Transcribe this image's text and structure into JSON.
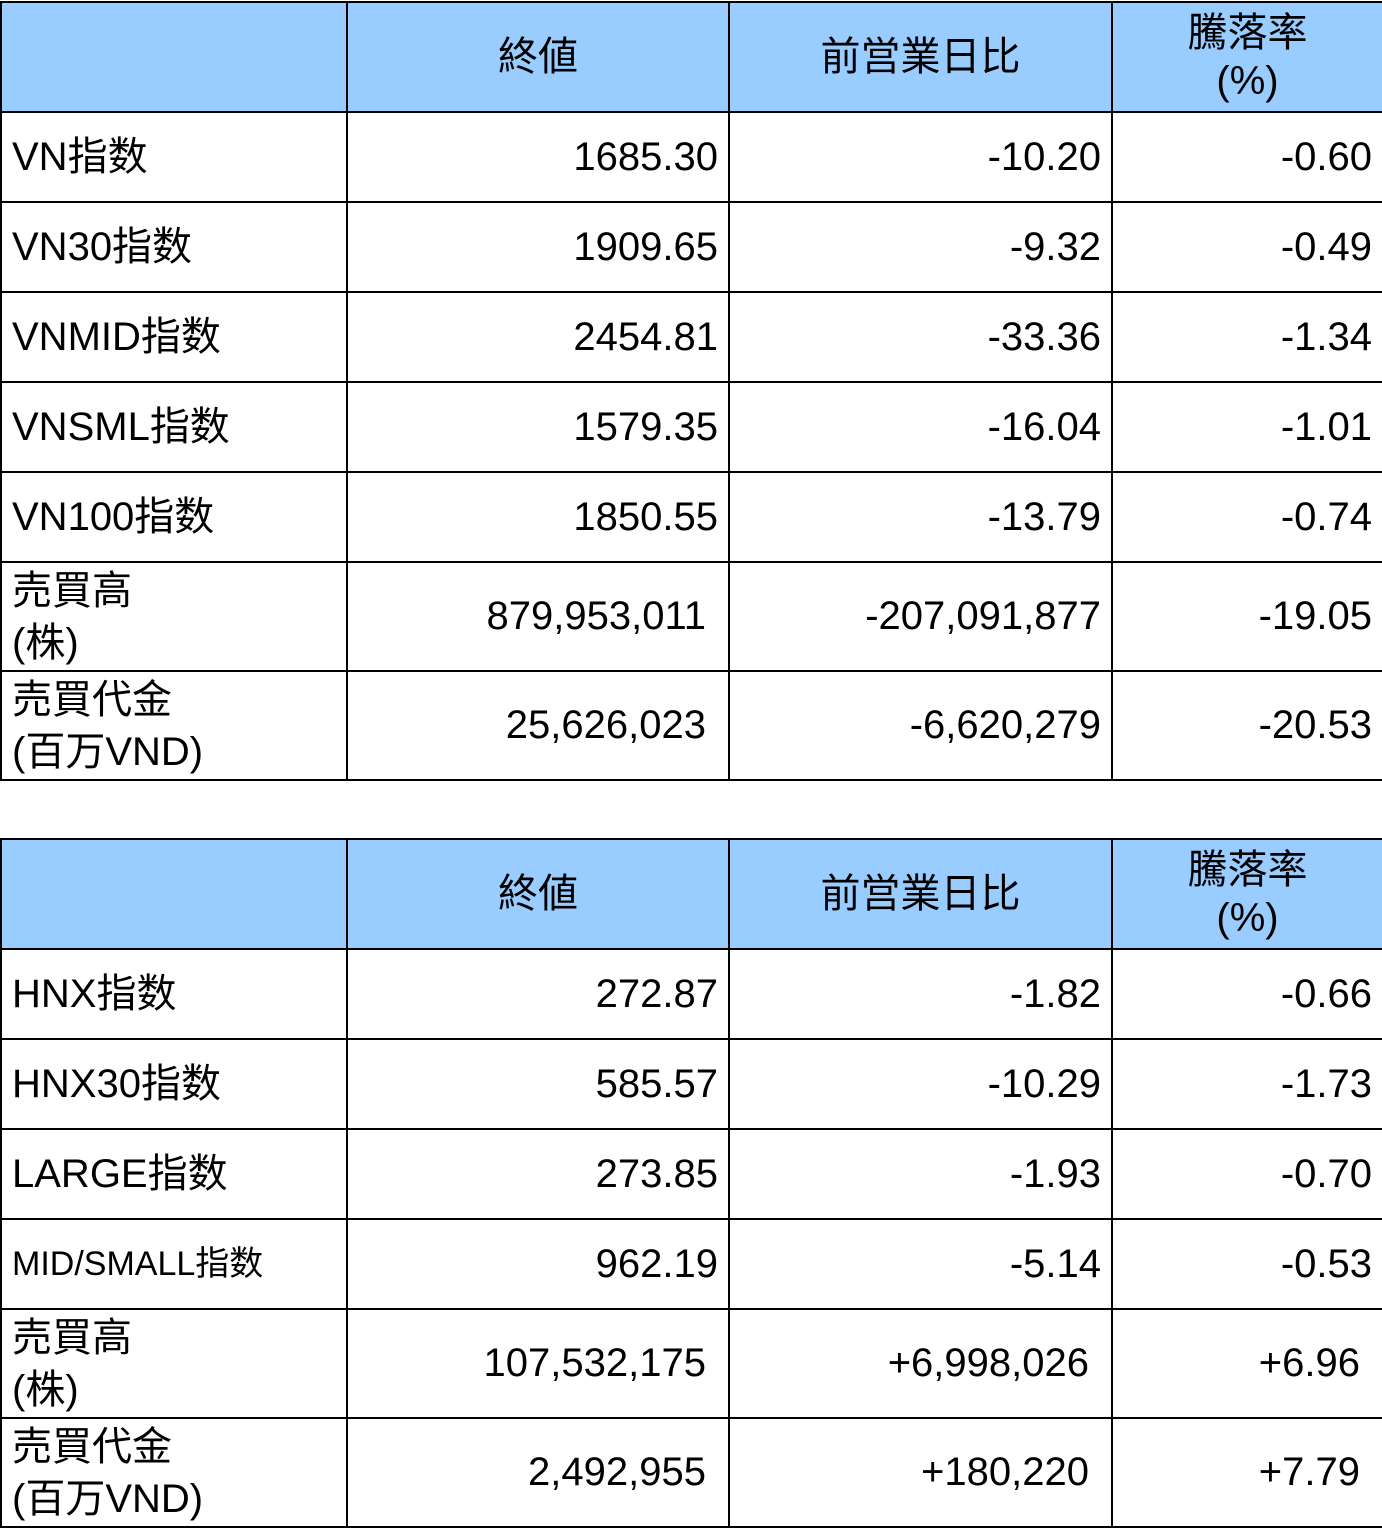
{
  "headers": {
    "col1": "",
    "close": "終値",
    "change": "前営業日比",
    "rate_line1": "騰落率",
    "rate_line2": "(%)"
  },
  "hose": {
    "rows": [
      {
        "label": "VN指数",
        "close": "1685.30",
        "change": "-10.20",
        "rate": "-0.60"
      },
      {
        "label": "VN30指数",
        "close": "1909.65",
        "change": "-9.32",
        "rate": "-0.49"
      },
      {
        "label": "VNMID指数",
        "close": "2454.81",
        "change": "-33.36",
        "rate": "-1.34"
      },
      {
        "label": "VNSML指数",
        "close": "1579.35",
        "change": "-16.04",
        "rate": "-1.01"
      },
      {
        "label": "VN100指数",
        "close": "1850.55",
        "change": "-13.79",
        "rate": "-0.74"
      }
    ],
    "volume": {
      "label_line1": "売買高",
      "label_line2": "(株)",
      "close": "879,953,011",
      "change": "-207,091,877",
      "rate": "-19.05"
    },
    "value": {
      "label_line1": "売買代金",
      "label_line2": "(百万VND)",
      "close": "25,626,023",
      "change": "-6,620,279",
      "rate": "-20.53"
    }
  },
  "hnx": {
    "rows": [
      {
        "label": "HNX指数",
        "close": "272.87",
        "change": "-1.82",
        "rate": "-0.66"
      },
      {
        "label": "HNX30指数",
        "close": "585.57",
        "change": "-10.29",
        "rate": "-1.73"
      },
      {
        "label": "LARGE指数",
        "close": "273.85",
        "change": "-1.93",
        "rate": "-0.70"
      },
      {
        "label": "MID/SMALL指数",
        "close": "962.19",
        "change": "-5.14",
        "rate": "-0.53"
      }
    ],
    "volume": {
      "label_line1": "売買高",
      "label_line2": "(株)",
      "close": "107,532,175",
      "change": "+6,998,026",
      "rate": "+6.96"
    },
    "value": {
      "label_line1": "売買代金",
      "label_line2": "(百万VND)",
      "close": "2,492,955",
      "change": "+180,220",
      "rate": "+7.79"
    }
  },
  "colors": {
    "header_bg": "#99ccff",
    "border": "#000000",
    "text": "#000000"
  }
}
